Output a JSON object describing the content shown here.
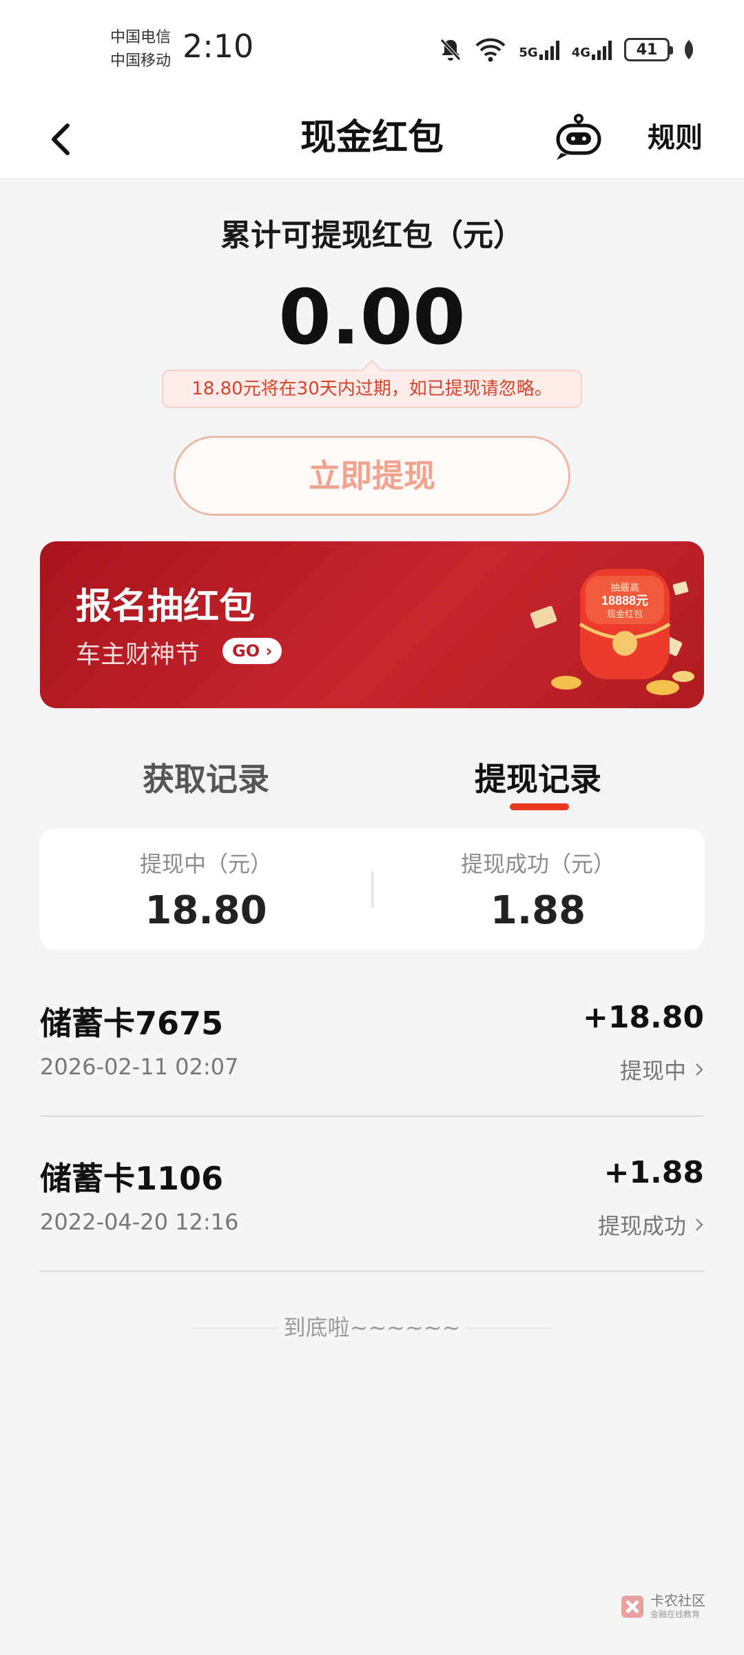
{
  "status_bar": {
    "carrier_1": "中国电信",
    "carrier_2": "中国移动",
    "time": "2:10",
    "net_1": "5G",
    "net_2": "4G",
    "battery": "41"
  },
  "header": {
    "title": "现金红包",
    "rules_label": "规则"
  },
  "balance": {
    "label": "累计可提现红包（元）",
    "value": "0.00",
    "expire_note": "18.80元将在30天内过期，如已提现请忽略。",
    "withdraw_button": "立即提现"
  },
  "banner": {
    "title": "报名抽红包",
    "subtitle": "车主财神节",
    "go_label": "GO",
    "art_text_1": "抽最高",
    "art_text_2": "18888元",
    "art_text_3": "现金红包"
  },
  "tabs": [
    {
      "label": "获取记录",
      "active": false
    },
    {
      "label": "提现记录",
      "active": true
    }
  ],
  "summary": {
    "pending_label": "提现中（元）",
    "pending_value": "18.80",
    "success_label": "提现成功（元）",
    "success_value": "1.88"
  },
  "records": [
    {
      "name": "储蓄卡7675",
      "date": "2026-02-11 02:07",
      "amount": "+18.80",
      "status": "提现中"
    },
    {
      "name": "储蓄卡1106",
      "date": "2022-04-20 12:16",
      "amount": "+1.88",
      "status": "提现成功"
    }
  ],
  "footer": {
    "end_text": "到底啦~~~~~~"
  },
  "watermark": {
    "name": "卡农社区",
    "sub": "金融在线教育"
  },
  "colors": {
    "accent": "#e8381f",
    "banner_red": "#b01c20",
    "note_text": "#d8442b"
  }
}
